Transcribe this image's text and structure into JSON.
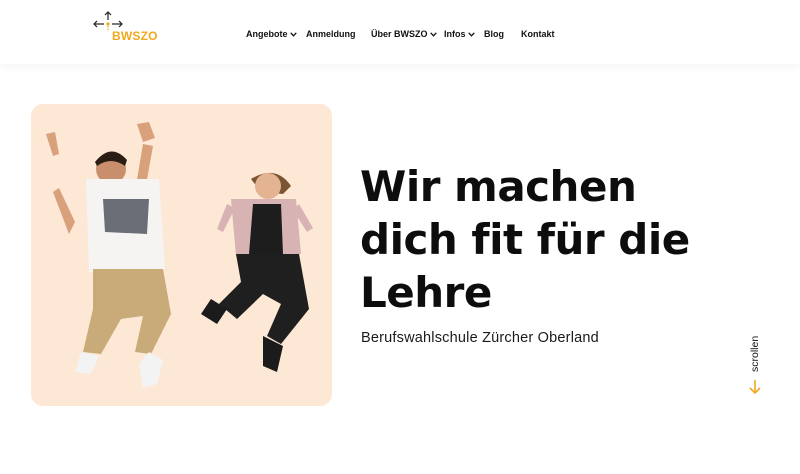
{
  "brand": {
    "name": "BWSZO",
    "accent_color": "#f2a81d"
  },
  "nav": {
    "items": [
      {
        "label": "Angebote",
        "has_dropdown": true
      },
      {
        "label": "Anmeldung",
        "has_dropdown": false
      },
      {
        "label": "Über BWSZO",
        "has_dropdown": true
      },
      {
        "label": "Infos",
        "has_dropdown": true
      },
      {
        "label": "Blog",
        "has_dropdown": false
      },
      {
        "label": "Kontakt",
        "has_dropdown": false
      }
    ]
  },
  "hero": {
    "headline_lines": [
      "Wir machen",
      "dich fit für die",
      "Lehre"
    ],
    "subtitle": "Berufswahlschule Zürcher Oberland",
    "image_background": "#fde8d6",
    "scroll_label": "scrollen"
  }
}
